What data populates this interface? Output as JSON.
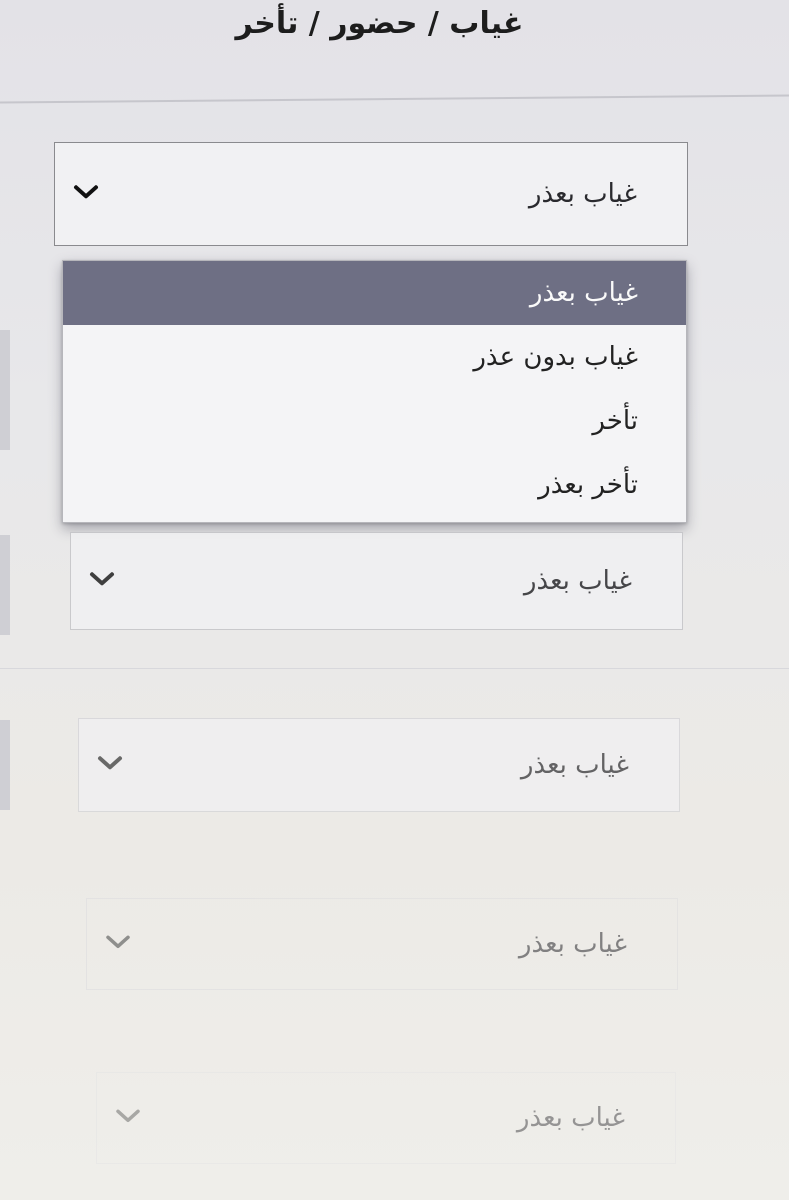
{
  "header": {
    "title": "غياب / حضور / تأخر"
  },
  "dropdowns": [
    {
      "value": "غياب بعذر"
    },
    {
      "value": "غياب بعذر"
    },
    {
      "value": "غياب بعذر"
    },
    {
      "value": "غياب بعذر"
    },
    {
      "value": "غياب بعذر"
    }
  ],
  "menu": {
    "options": [
      {
        "label": "غياب بعذر",
        "selected": true
      },
      {
        "label": "غياب بدون عذر",
        "selected": false
      },
      {
        "label": "تأخر",
        "selected": false
      },
      {
        "label": "تأخر بعذر",
        "selected": false
      }
    ]
  },
  "icons": {
    "chevron": "chevron-down-icon"
  },
  "colors": {
    "highlight": "#6e6f84",
    "border": "#8a8a8e",
    "text": "#222222"
  }
}
